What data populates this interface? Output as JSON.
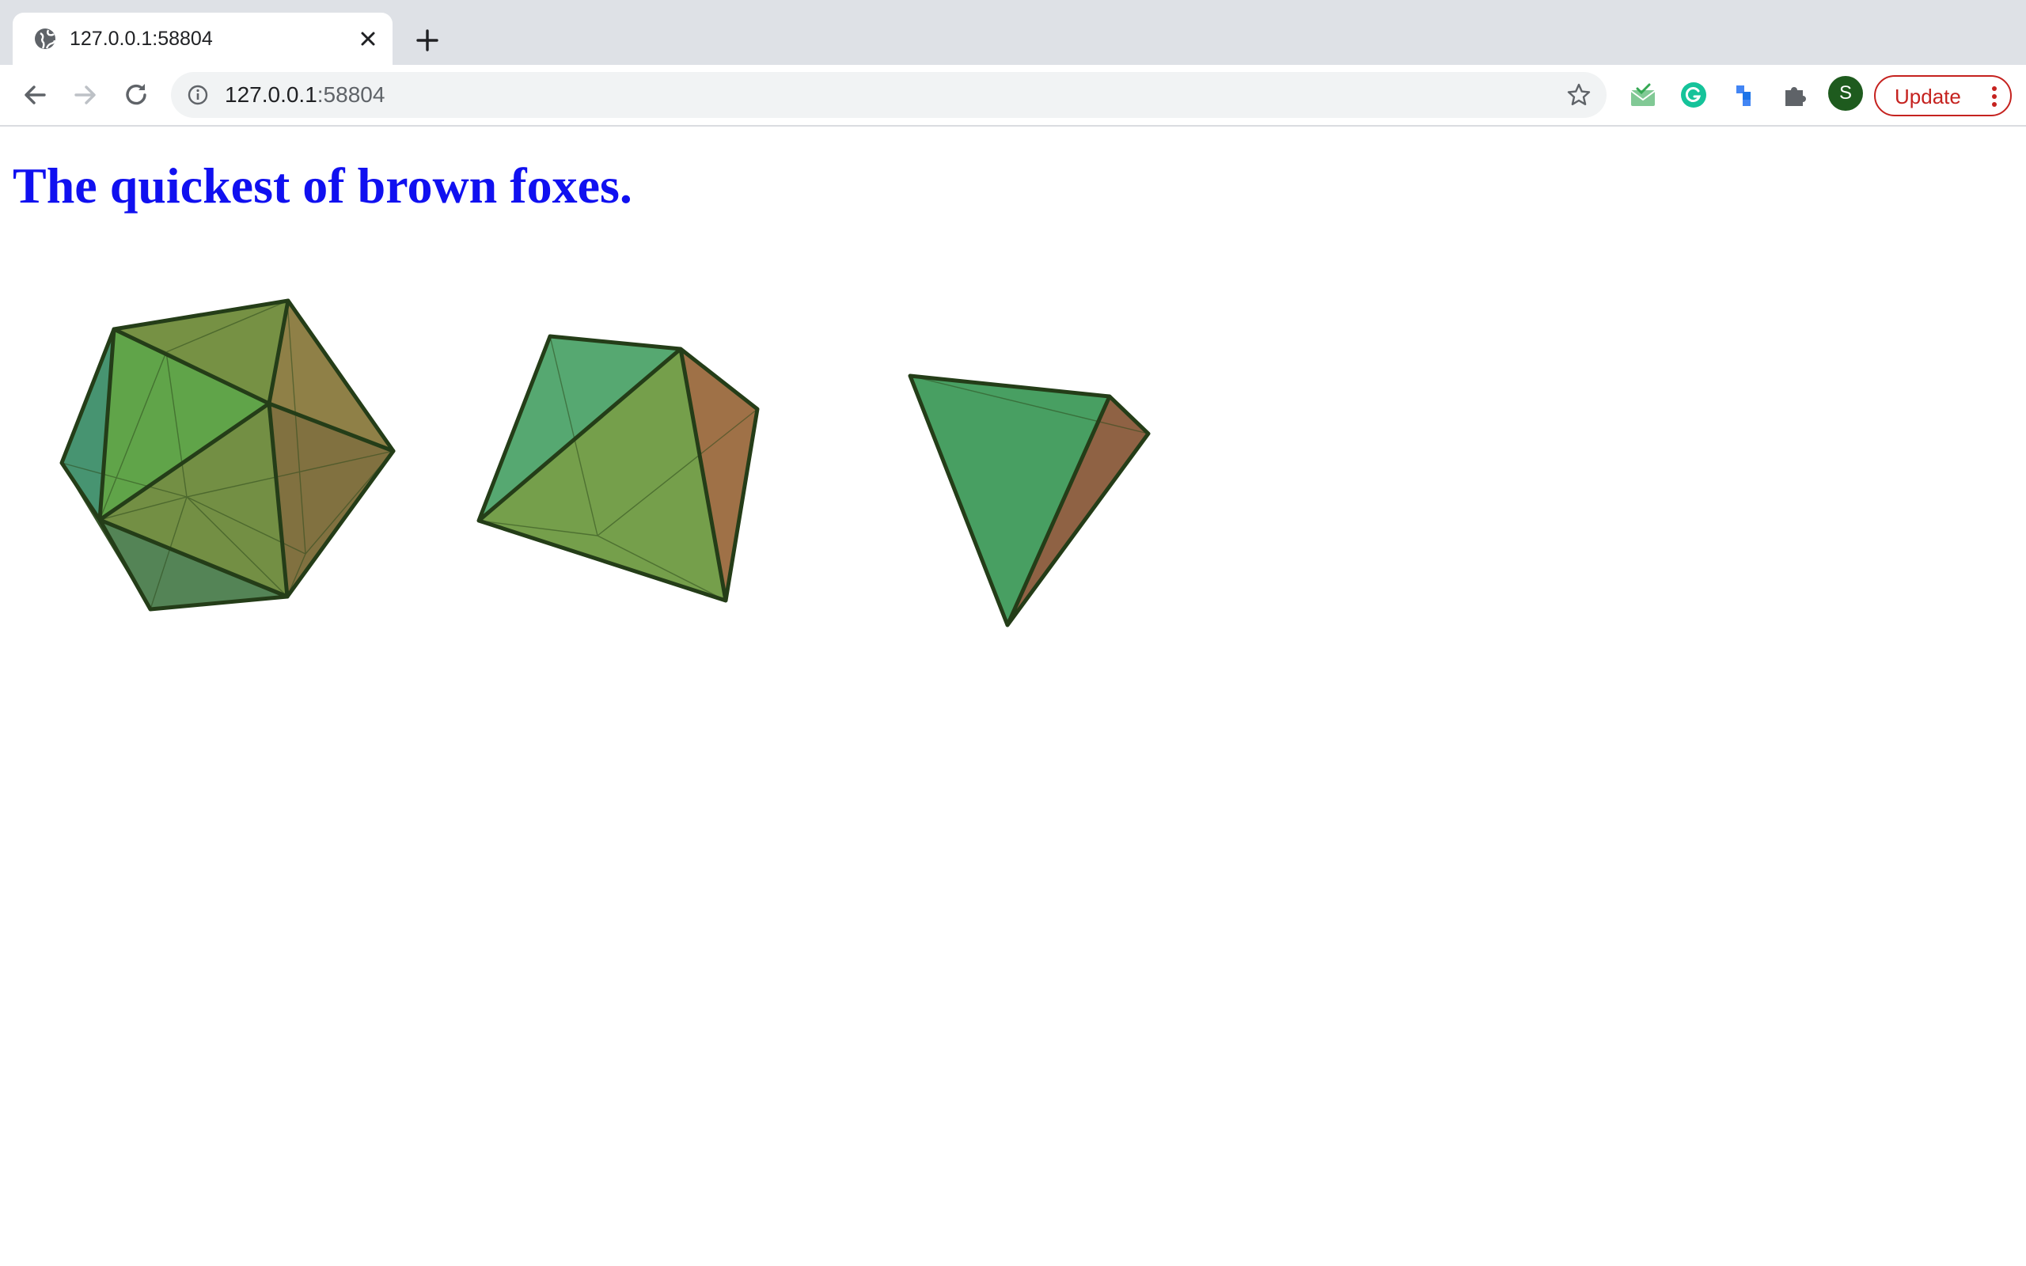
{
  "browser": {
    "tab": {
      "title": "127.0.0.1:58804",
      "favicon": "globe-icon"
    },
    "address": {
      "host": "127.0.0.1",
      "port": ":58804"
    },
    "update_label": "Update",
    "profile_initial": "S",
    "extensions": [
      "mail-check-icon",
      "grammarly-icon",
      "blocks-extension-icon",
      "puzzle-icon"
    ]
  },
  "page": {
    "heading": "The quickest of brown foxes.",
    "heading_color": "#1010f0",
    "shapes": [
      "icosahedron",
      "octahedron",
      "tetrahedron"
    ]
  }
}
